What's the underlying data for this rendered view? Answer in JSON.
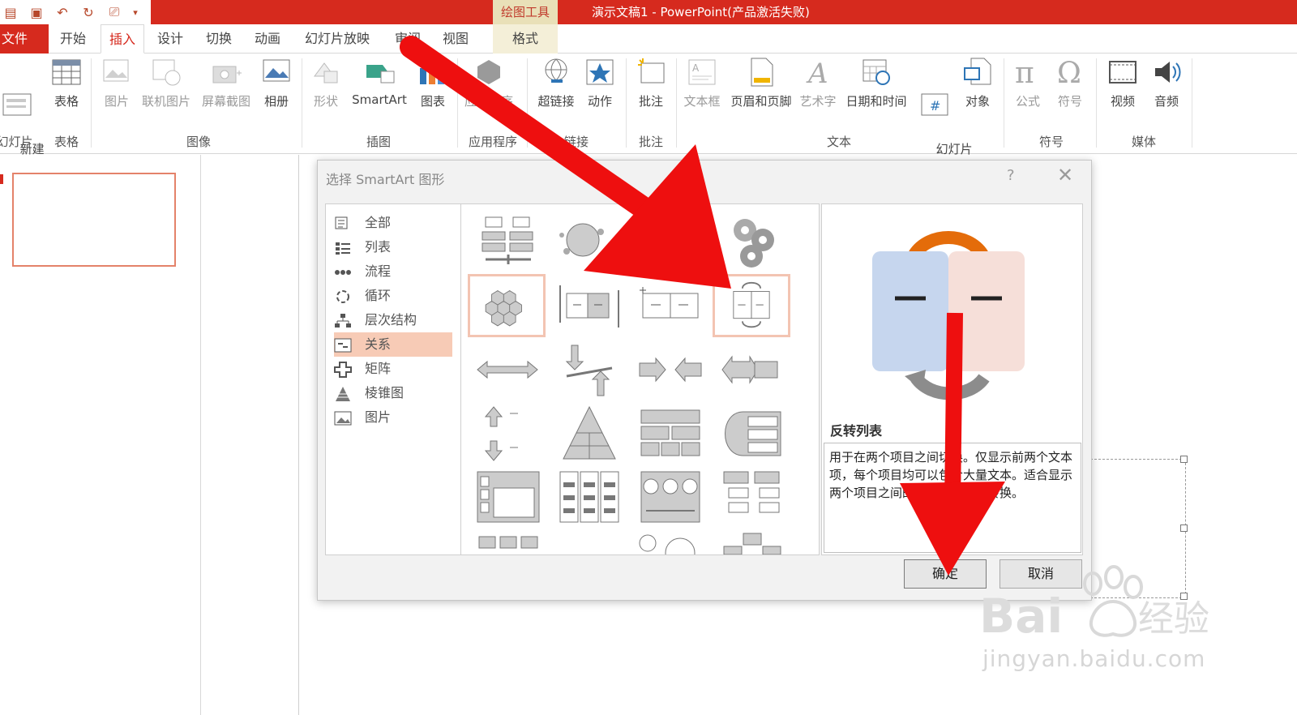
{
  "titlebar": {
    "context_tools": "绘图工具",
    "window_title": "演示文稿1 - PowerPoint(产品激活失败)"
  },
  "tabs": [
    {
      "label": "文件"
    },
    {
      "label": "开始"
    },
    {
      "label": "插入"
    },
    {
      "label": "设计"
    },
    {
      "label": "切换"
    },
    {
      "label": "动画"
    },
    {
      "label": "幻灯片放映"
    },
    {
      "label": "审阅"
    },
    {
      "label": "视图"
    },
    {
      "label": "格式"
    }
  ],
  "ribbon": {
    "items": {
      "new_slide": "新建\n幻灯片",
      "table": "表格",
      "picture": "图片",
      "online_picture": "联机图片",
      "screenshot": "屏幕截图",
      "album": "相册",
      "shapes": "形状",
      "smartart": "SmartArt",
      "chart": "图表",
      "apps": "应用程序",
      "hyperlink": "超链接",
      "action": "动作",
      "comment": "批注",
      "textbox": "文本框",
      "header_footer": "页眉和页脚",
      "wordart": "艺术字",
      "datetime": "日期和时间",
      "slide_number": "幻灯片\n编号",
      "object": "对象",
      "equation": "公式",
      "symbol": "符号",
      "video": "视频",
      "audio": "音频"
    },
    "groups": {
      "slides": "幻灯片",
      "tables": "表格",
      "images": "图像",
      "illustrations": "插图",
      "apps": "应用程序",
      "links": "链接",
      "comments": "批注",
      "text": "文本",
      "symbols": "符号",
      "media": "媒体"
    }
  },
  "dialog": {
    "title": "选择 SmartArt 图形",
    "help": "?",
    "close": "✕",
    "categories": [
      "全部",
      "列表",
      "流程",
      "循环",
      "层次结构",
      "关系",
      "矩阵",
      "棱锥图",
      "图片"
    ],
    "selected_category": "关系",
    "preview": {
      "name": "反转列表",
      "description": "用于在两个项目之间切换。仅显示前两个文本项，每个项目均可以包含大量文本。适合显示两个项目之间的切换或按顺序转换。"
    },
    "buttons": {
      "ok": "确定",
      "cancel": "取消"
    }
  },
  "watermark": {
    "text": "jingyan.baidu.com"
  },
  "colors": {
    "accent": "#d62a1e",
    "selection": "#f7cbb6",
    "arrow": "#ee0f0f"
  }
}
